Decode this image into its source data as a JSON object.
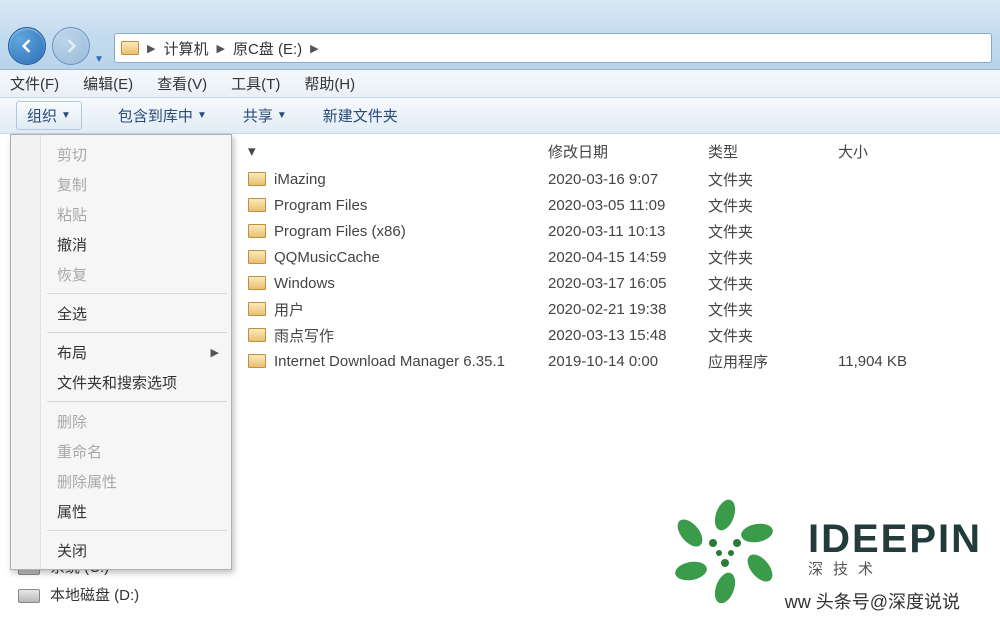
{
  "breadcrumb": {
    "computer": "计算机",
    "drive": "原C盘 (E:)"
  },
  "menubar": {
    "file": "文件(F)",
    "edit": "编辑(E)",
    "view": "查看(V)",
    "tools": "工具(T)",
    "help": "帮助(H)"
  },
  "toolbar": {
    "organize": "组织",
    "include": "包含到库中",
    "share": "共享",
    "newfolder": "新建文件夹"
  },
  "context_menu": {
    "cut": "剪切",
    "copy": "复制",
    "paste": "粘贴",
    "undo": "撤消",
    "redo": "恢复",
    "select_all": "全选",
    "layout": "布局",
    "folder_options": "文件夹和搜索选项",
    "delete": "删除",
    "rename": "重命名",
    "remove_props": "删除属性",
    "properties": "属性",
    "close": "关闭"
  },
  "columns": {
    "name_sort": "▾",
    "date": "修改日期",
    "type": "类型",
    "size": "大小"
  },
  "files": [
    {
      "name": "iMazing",
      "date": "2020-03-16 9:07",
      "type": "文件夹",
      "size": ""
    },
    {
      "name": "Program Files",
      "date": "2020-03-05 11:09",
      "type": "文件夹",
      "size": ""
    },
    {
      "name": "Program Files (x86)",
      "date": "2020-03-11 10:13",
      "type": "文件夹",
      "size": ""
    },
    {
      "name": "QQMusicCache",
      "date": "2020-04-15 14:59",
      "type": "文件夹",
      "size": ""
    },
    {
      "name": "Windows",
      "date": "2020-03-17 16:05",
      "type": "文件夹",
      "size": ""
    },
    {
      "name": "用户",
      "date": "2020-02-21 19:38",
      "type": "文件夹",
      "size": ""
    },
    {
      "name": "雨点写作",
      "date": "2020-03-13 15:48",
      "type": "文件夹",
      "size": ""
    },
    {
      "name": "Internet Download Manager 6.35.1",
      "date": "2019-10-14 0:00",
      "type": "应用程序",
      "size": "11,904 KB"
    }
  ],
  "sidebar": {
    "drive_c": "系统 (C:)",
    "drive_d": "本地磁盘 (D:)"
  },
  "watermark": {
    "brand": "IDEEPIN",
    "sub_a": "深",
    "sub_b": "技",
    "sub_c": "术",
    "credit": "ww 头条号@深度说说"
  }
}
